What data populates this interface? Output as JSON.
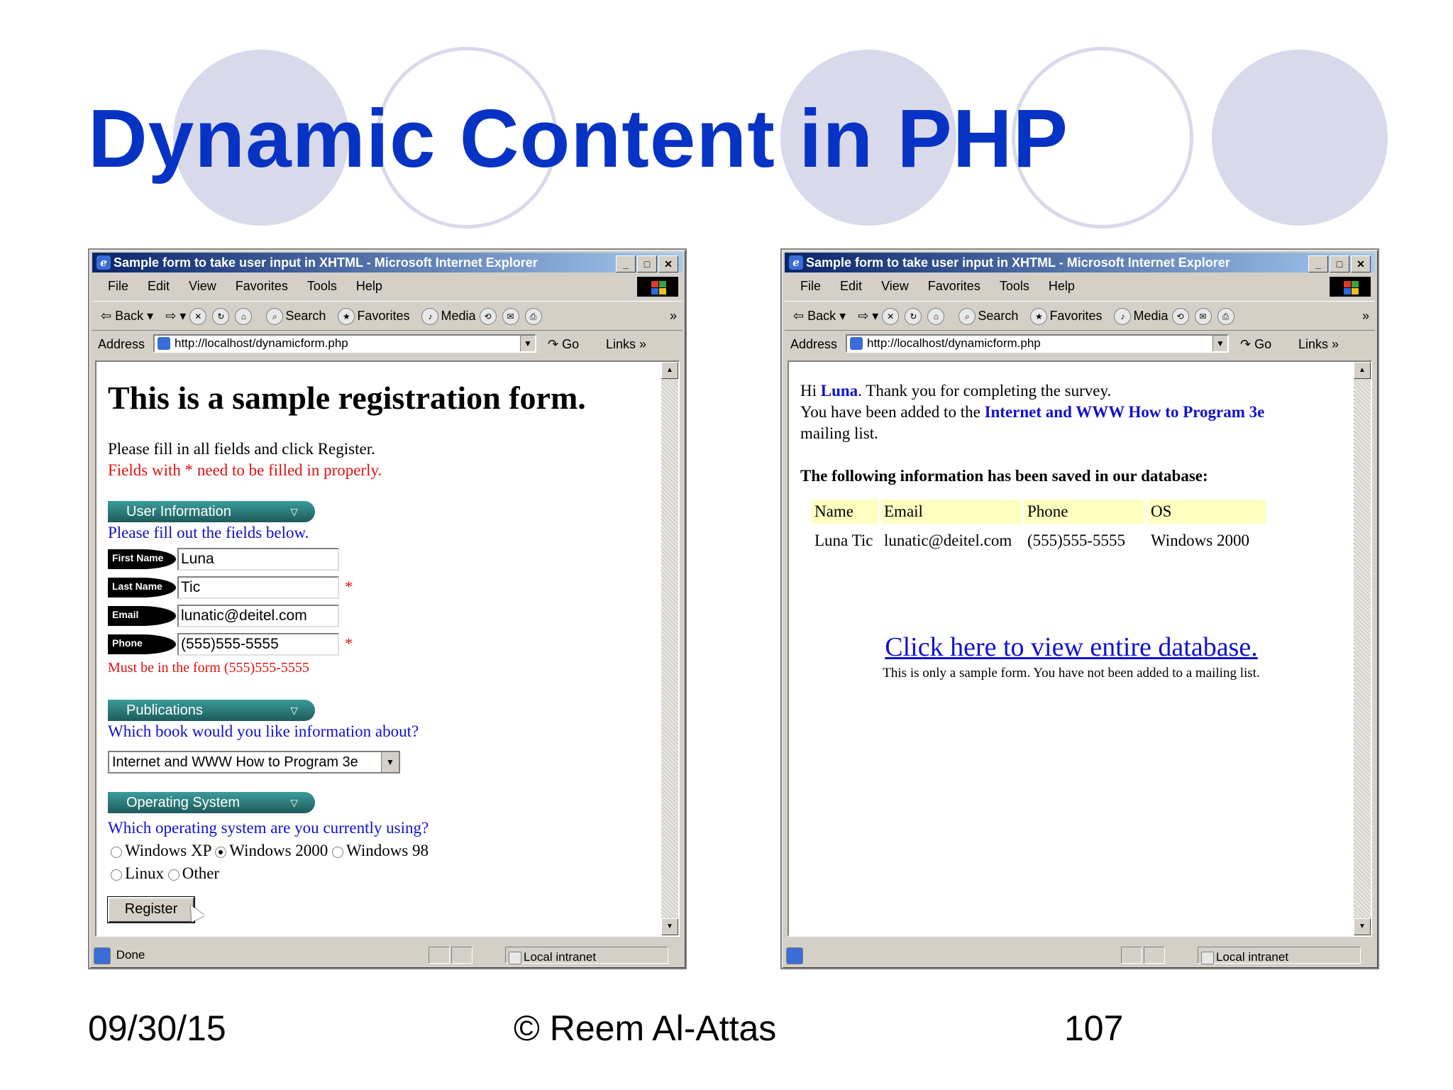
{
  "slide": {
    "title": "Dynamic Content in PHP",
    "footer_date": "09/30/15",
    "footer_author": "© Reem Al-Attas",
    "footer_page": "107"
  },
  "browser": {
    "title": "Sample form to take user input in XHTML - Microsoft Internet Explorer",
    "menu": [
      "File",
      "Edit",
      "View",
      "Favorites",
      "Tools",
      "Help"
    ],
    "toolbar": {
      "back": "Back",
      "search": "Search",
      "favorites": "Favorites",
      "media": "Media"
    },
    "address_label": "Address",
    "address_url": "http://localhost/dynamicform.php",
    "go_label": "Go",
    "links_label": "Links",
    "zone": "Local intranet"
  },
  "left_page": {
    "heading": "This is a sample registration form.",
    "instructions": "Please fill in all fields and click Register.",
    "required_note": "Fields with * need to be filled in properly.",
    "section_user": "User Information",
    "user_prompt": "Please fill out the fields below.",
    "fields": [
      {
        "label": "First Name",
        "value": "Luna",
        "required": false
      },
      {
        "label": "Last Name",
        "value": "Tic",
        "required": true
      },
      {
        "label": "Email",
        "value": "lunatic@deitel.com",
        "required": false
      },
      {
        "label": "Phone",
        "value": "(555)555-5555",
        "required": true
      }
    ],
    "required_mark": "*",
    "phone_hint": "Must be in the form (555)555-5555",
    "section_pubs": "Publications",
    "pubs_prompt": "Which book would you like information about?",
    "book_selected": "Internet and WWW How to Program 3e",
    "section_os": "Operating System",
    "os_prompt": "Which operating system are you currently using?",
    "os_options": [
      "Windows XP",
      "Windows 2000",
      "Windows 98",
      "Linux",
      "Other"
    ],
    "os_selected": "Windows 2000",
    "register_label": "Register",
    "status": "Done"
  },
  "right_page": {
    "greeting_hi": "Hi",
    "greeting_name": "Luna",
    "greeting_rest": ". Thank you for completing the survey.",
    "added_prefix": "You have been added to the",
    "added_book": "Internet and WWW How to Program 3e",
    "added_suffix": "mailing list.",
    "saved_heading": "The following information has been saved in our database:",
    "table_headers": [
      "Name",
      "Email",
      "Phone",
      "OS"
    ],
    "table_row": [
      "Luna Tic",
      "lunatic@deitel.com",
      "(555)555-5555",
      "Windows 2000"
    ],
    "view_link": "Click here to view entire database.",
    "note": "This is only a sample form. You have not been added to a mailing list."
  }
}
